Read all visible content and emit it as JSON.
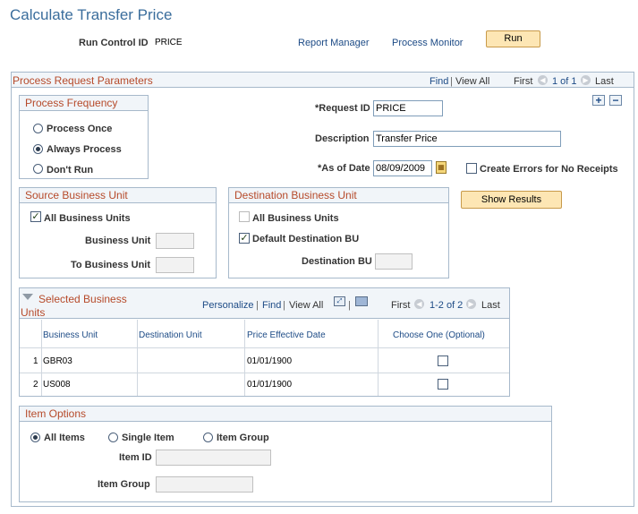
{
  "page": {
    "title": "Calculate Transfer Price"
  },
  "header": {
    "run_control_label": "Run Control ID",
    "run_control_value": "PRICE",
    "report_manager": "Report Manager",
    "process_monitor": "Process Monitor",
    "run_button": "Run"
  },
  "params": {
    "title": "Process Request Parameters",
    "nav": {
      "find": "Find",
      "view_all": "View All",
      "first": "First",
      "range": "1 of 1",
      "last": "Last"
    },
    "request_id_label": "*Request ID",
    "request_id_value": "PRICE",
    "description_label": "Description",
    "description_value": "Transfer Price",
    "as_of_label": "*As of Date",
    "as_of_value": "08/09/2009",
    "create_errors_label": "Create Errors for No Receipts",
    "show_results": "Show Results"
  },
  "frequency": {
    "title": "Process Frequency",
    "options": [
      "Process Once",
      "Always Process",
      "Don't Run"
    ],
    "selected": "Always Process"
  },
  "source_bu": {
    "title": "Source Business Unit",
    "all_label": "All Business Units",
    "bu_label": "Business Unit",
    "to_bu_label": "To Business Unit"
  },
  "dest_bu": {
    "title": "Destination Business Unit",
    "all_label": "All Business Units",
    "default_label": "Default Destination BU",
    "dest_label": "Destination BU"
  },
  "selected_bu": {
    "title_line1": "Selected Business",
    "title_line2": "Units",
    "nav": {
      "personalize": "Personalize",
      "find": "Find",
      "view_all": "View All",
      "first": "First",
      "range": "1-2 of 2",
      "last": "Last"
    },
    "columns": [
      "Business Unit",
      "Destination Unit",
      "Price Effective Date",
      "Choose One (Optional)"
    ],
    "rows": [
      {
        "num": "1",
        "bu": "GBR03",
        "dest": "",
        "date": "01/01/1900"
      },
      {
        "num": "2",
        "bu": "US008",
        "dest": "",
        "date": "01/01/1900"
      }
    ]
  },
  "item_options": {
    "title": "Item Options",
    "options": [
      "All Items",
      "Single Item",
      "Item Group"
    ],
    "selected": "All Items",
    "item_id_label": "Item ID",
    "item_group_label": "Item Group"
  }
}
